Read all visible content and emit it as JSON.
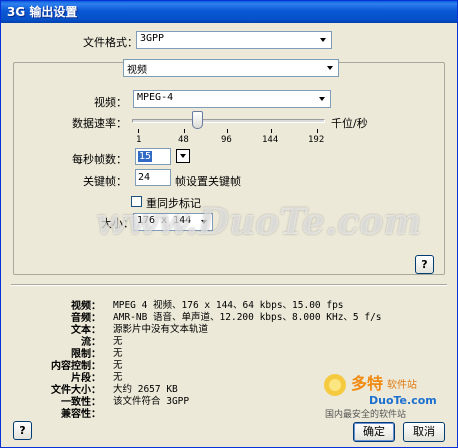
{
  "window": {
    "title": "3G 输出设置"
  },
  "format": {
    "label": "文件格式：",
    "value": "3GPP"
  },
  "track": {
    "value": "视频"
  },
  "video": {
    "codec_label": "视频：",
    "codec_value": "MPEG-4",
    "rate_label": "数据速率：",
    "rate_unit": "千位/秒",
    "ticks": [
      "1",
      "48",
      "96",
      "144",
      "192"
    ],
    "fps_label": "每秒帧数：",
    "fps_value": "15",
    "keyframe_label": "关键帧：",
    "keyframe_value": "24",
    "keyframe_suffix": "帧设置关键帧",
    "sync_label": "重同步标记",
    "size_label": "大小：",
    "size_value": "176 x 144"
  },
  "summary": [
    {
      "key": "视频：",
      "value": "MPEG 4 视频、176 x 144、64 kbps、15.00 fps"
    },
    {
      "key": "音频：",
      "value": "AMR-NB 语音、单声道、12.200 kbps、8.000 KHz、5 f/s"
    },
    {
      "key": "文本：",
      "value": "源影片中没有文本轨道"
    },
    {
      "key": "流：",
      "value": "无"
    },
    {
      "key": "限制：",
      "value": "无"
    },
    {
      "key": "内容控制：",
      "value": "无"
    },
    {
      "key": "片段：",
      "value": "无"
    },
    {
      "key": "文件大小：",
      "value": "大约 2657 KB"
    },
    {
      "key": "一致性：",
      "value": "该文件符合 3GPP"
    },
    {
      "key": "兼容性：",
      "value": ""
    }
  ],
  "buttons": {
    "help": "?",
    "help_main": "?",
    "ok": "确定",
    "cancel": "取消"
  },
  "watermark": "www.DuoTe.com",
  "logo": {
    "text": "多特",
    "subtitle": "软件站",
    "url": "DuoTe.com",
    "caption": "国内最安全的软件站"
  }
}
